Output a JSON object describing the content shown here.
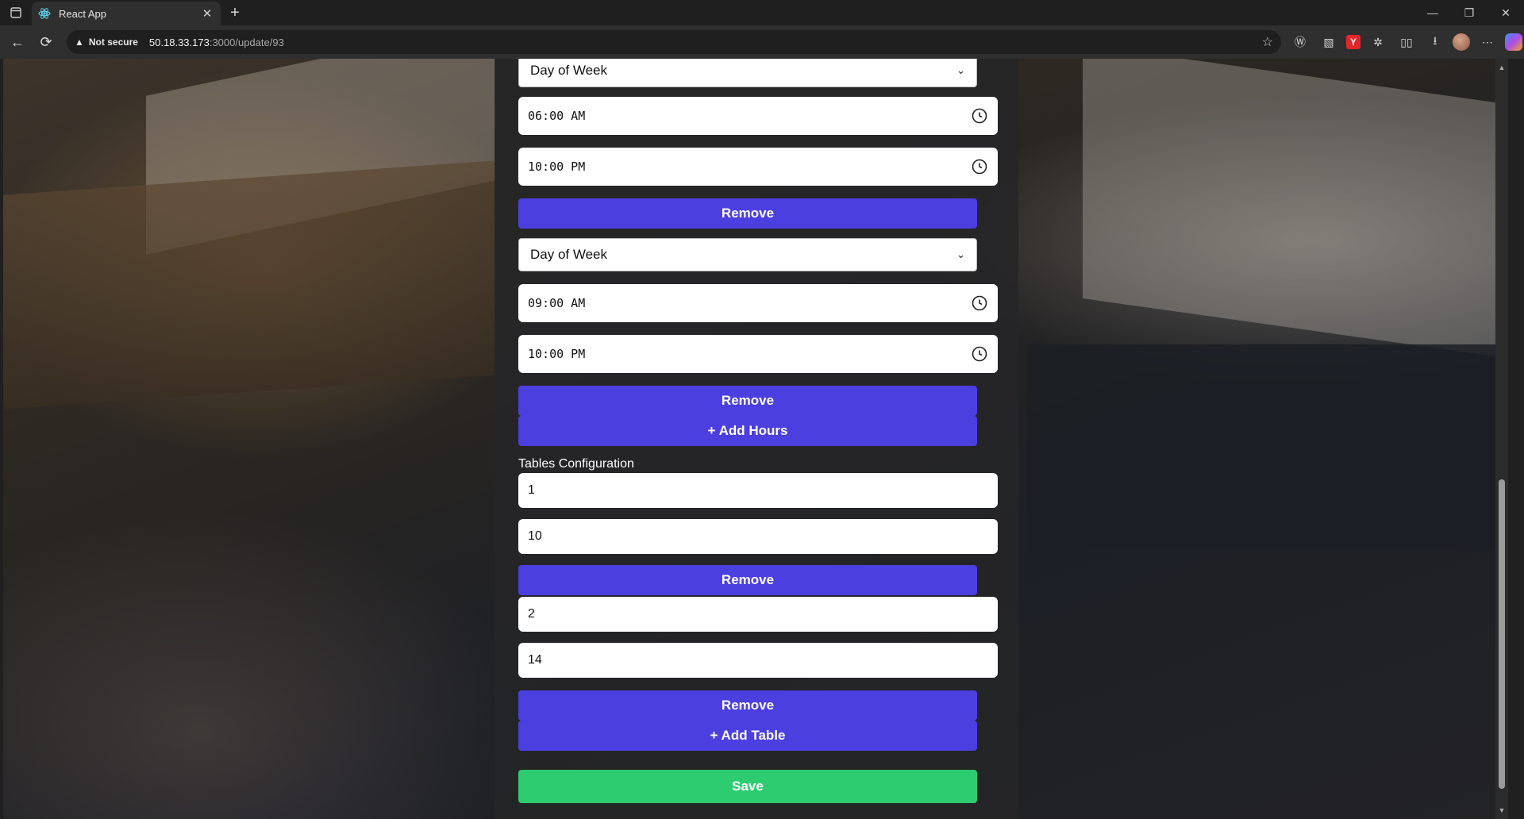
{
  "browser": {
    "tab_title": "React App",
    "new_tab_label": "+",
    "security_label": "Not secure",
    "url_host": "50.18.33.173",
    "url_path": ":3000/update/93"
  },
  "form": {
    "hours": [
      {
        "day_placeholder": "Day of Week",
        "open_time": "06:00 AM",
        "close_time": "10:00 PM",
        "remove_label": "Remove"
      },
      {
        "day_placeholder": "Day of Week",
        "open_time": "09:00 AM",
        "close_time": "10:00 PM",
        "remove_label": "Remove"
      }
    ],
    "add_hours_label": "+ Add Hours",
    "tables_label": "Tables Configuration",
    "tables": [
      {
        "table_number": "1",
        "capacity": "10",
        "remove_label": "Remove"
      },
      {
        "table_number": "2",
        "capacity": "14",
        "remove_label": "Remove"
      }
    ],
    "add_table_label": "+ Add Table",
    "save_label": "Save"
  },
  "colors": {
    "primary_button": "#4c3fe0",
    "save_button": "#2ecc71"
  }
}
